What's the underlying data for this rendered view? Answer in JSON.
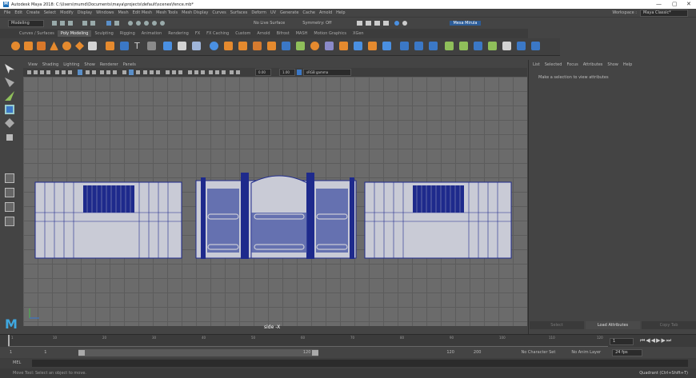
{
  "window": {
    "title": "Autodesk Maya 2018: C:\\Users\\mumd\\Documents\\maya\\projects\\default\\scenes\\fence.mb*",
    "minimize": "—",
    "maximize": "▢",
    "close": "✕"
  },
  "menubar": {
    "items": [
      "File",
      "Edit",
      "Create",
      "Select",
      "Modify",
      "Display",
      "Windows",
      "Mesh",
      "Edit Mesh",
      "Mesh Tools",
      "Mesh Display",
      "Curves",
      "Surfaces",
      "Deform",
      "UV",
      "Generate",
      "Cache",
      "Arnold",
      "Help"
    ],
    "workspace_label": "Workspace :",
    "workspace_value": "Maya Classic*"
  },
  "statusline": {
    "mode": "Modeling",
    "no_live": "No Live Surface",
    "symmetry": "Symmetry: Off",
    "user": "Mesa Mirula"
  },
  "shelf_tabs": [
    "Curves / Surfaces",
    "Poly Modeling",
    "Sculpting",
    "Rigging",
    "Animation",
    "Rendering",
    "FX",
    "FX Caching",
    "Custom",
    "Arnold",
    "Bifrost",
    "MASH",
    "Motion Graphics",
    "XGen"
  ],
  "shelf_active": "Poly Modeling",
  "viewport": {
    "menu": [
      "View",
      "Shading",
      "Lighting",
      "Show",
      "Renderer",
      "Panels"
    ],
    "field1": "0.00",
    "field2": "1.00",
    "colorspace": "sRGB gamma",
    "label": "side -X"
  },
  "attr_panel": {
    "menu": [
      "List",
      "Selected",
      "Focus",
      "Attributes",
      "Show",
      "Help"
    ],
    "message": "Make a selection to view attributes",
    "bottom": [
      "Select",
      "Load Attributes",
      "Copy Tab"
    ]
  },
  "timeslider": {
    "ticks": [
      "1",
      "10",
      "20",
      "30",
      "40",
      "50",
      "60",
      "70",
      "80",
      "90",
      "100",
      "110",
      "120"
    ],
    "current": "1"
  },
  "rangebar": {
    "start": "1",
    "start2": "1",
    "range_end": "120",
    "end": "120",
    "end2": "200",
    "character_set": "No Character Set",
    "anim_layer": "No Anim Layer",
    "fps": "24 fps"
  },
  "melbar": {
    "label": "MEL"
  },
  "helpline": {
    "text": "Move Tool: Select an object to move.",
    "quadrant": "Quadrant (Ctrl+Shift+T)"
  },
  "colors": {
    "accent": "#1d6fb8",
    "wire": "#1e2a8c",
    "viewport_bg": "#6b6b6b",
    "fence_panel": "#c9cbd6"
  }
}
